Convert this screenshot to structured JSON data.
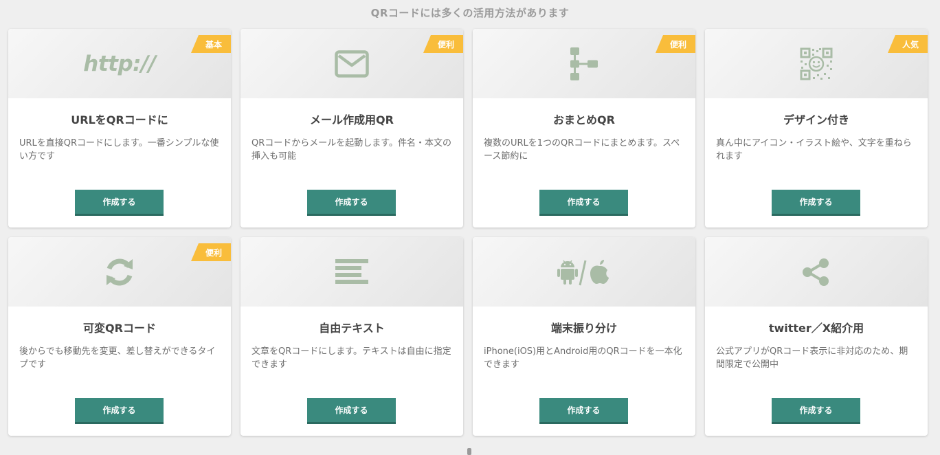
{
  "heading": "QRコードには多くの活用方法があります",
  "colors": {
    "accent": "#3a8a7e",
    "badge": "#f9bd3b",
    "icon": "#a9bca6"
  },
  "cards": [
    {
      "badge": "基本",
      "icon": "http-text-icon",
      "icon_text": "http://",
      "title": "URLをQRコードに",
      "desc": "URLを直接QRコードにします。一番シンプルな使い方です",
      "button": "作成する"
    },
    {
      "badge": "便利",
      "icon": "envelope-icon",
      "title": "メール作成用QR",
      "desc": "QRコードからメールを起動します。件名・本文の挿入も可能",
      "button": "作成する"
    },
    {
      "badge": "便利",
      "icon": "sitemap-icon",
      "title": "おまとめQR",
      "desc": "複数のURLを1つのQRコードにまとめます。スペース節約に",
      "button": "作成する"
    },
    {
      "badge": "人気",
      "icon": "qr-smiley-icon",
      "title": "デザイン付き",
      "desc": "真ん中にアイコン・イラスト絵や、文字を重ねられます",
      "button": "作成する"
    },
    {
      "badge": "便利",
      "icon": "refresh-icon",
      "title": "可変QRコード",
      "desc": "後からでも移動先を変更、差し替えができるタイプです",
      "button": "作成する"
    },
    {
      "badge": "",
      "icon": "align-left-icon",
      "title": "自由テキスト",
      "desc": "文章をQRコードにします。テキストは自由に指定できます",
      "button": "作成する"
    },
    {
      "badge": "",
      "icon": "android-apple-icon",
      "title": "端末振り分け",
      "desc": "iPhone(iOS)用とAndroid用のQRコードを一本化できます",
      "button": "作成する"
    },
    {
      "badge": "",
      "icon": "share-icon",
      "title": "twitter／X紹介用",
      "desc": "公式アプリがQRコード表示に非対応のため、期間限定で公開中",
      "button": "作成する"
    }
  ]
}
